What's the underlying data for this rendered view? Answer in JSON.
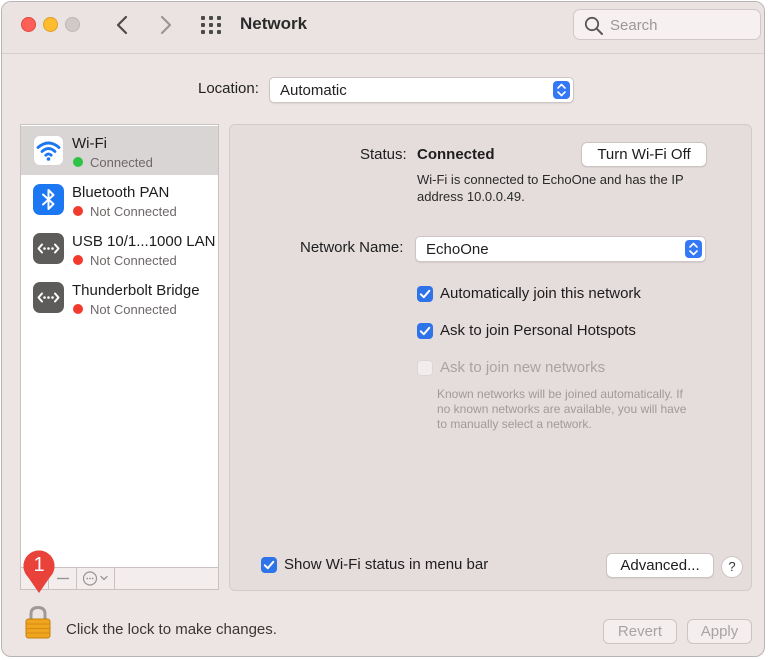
{
  "window": {
    "title": "Network",
    "search_placeholder": "Search"
  },
  "location": {
    "label": "Location:",
    "value": "Automatic"
  },
  "services": [
    {
      "name": "Wi-Fi",
      "status": "Connected",
      "status_color": "#2ec343",
      "icon": "wifi-icon"
    },
    {
      "name": "Bluetooth PAN",
      "status": "Not Connected",
      "status_color": "#f33a2f",
      "icon": "bluetooth-icon"
    },
    {
      "name": "USB 10/1...1000 LAN",
      "status": "Not Connected",
      "status_color": "#f33a2f",
      "icon": "ethernet-icon"
    },
    {
      "name": "Thunderbolt Bridge",
      "status": "Not Connected",
      "status_color": "#f33a2f",
      "icon": "ethernet-icon"
    }
  ],
  "detail": {
    "status_label": "Status:",
    "status_value": "Connected",
    "toggle_button": "Turn Wi-Fi Off",
    "status_desc_line1": "Wi-Fi is connected to EchoOne and has the IP",
    "status_desc_line2": "address 10.0.0.49.",
    "network_name_label": "Network Name:",
    "network_name_value": "EchoOne",
    "options": [
      {
        "label": "Automatically join this network",
        "checked": true,
        "enabled": true
      },
      {
        "label": "Ask to join Personal Hotspots",
        "checked": true,
        "enabled": true
      },
      {
        "label": "Ask to join new networks",
        "checked": false,
        "enabled": false
      }
    ],
    "note_line1": "Known networks will be joined automatically. If",
    "note_line2": "no known networks are available, you will have",
    "note_line3": "to manually select a network.",
    "show_status_label": "Show Wi-Fi status in menu bar",
    "advanced_button": "Advanced...",
    "help_button": "?"
  },
  "footer": {
    "lock_text": "Click the lock to make changes.",
    "revert_button": "Revert",
    "apply_button": "Apply"
  },
  "annotation": {
    "badge_number": "1",
    "badge_color": "#e8423a"
  },
  "colors": {
    "accent": "#3478f6",
    "window_bg": "#ede5e4"
  }
}
